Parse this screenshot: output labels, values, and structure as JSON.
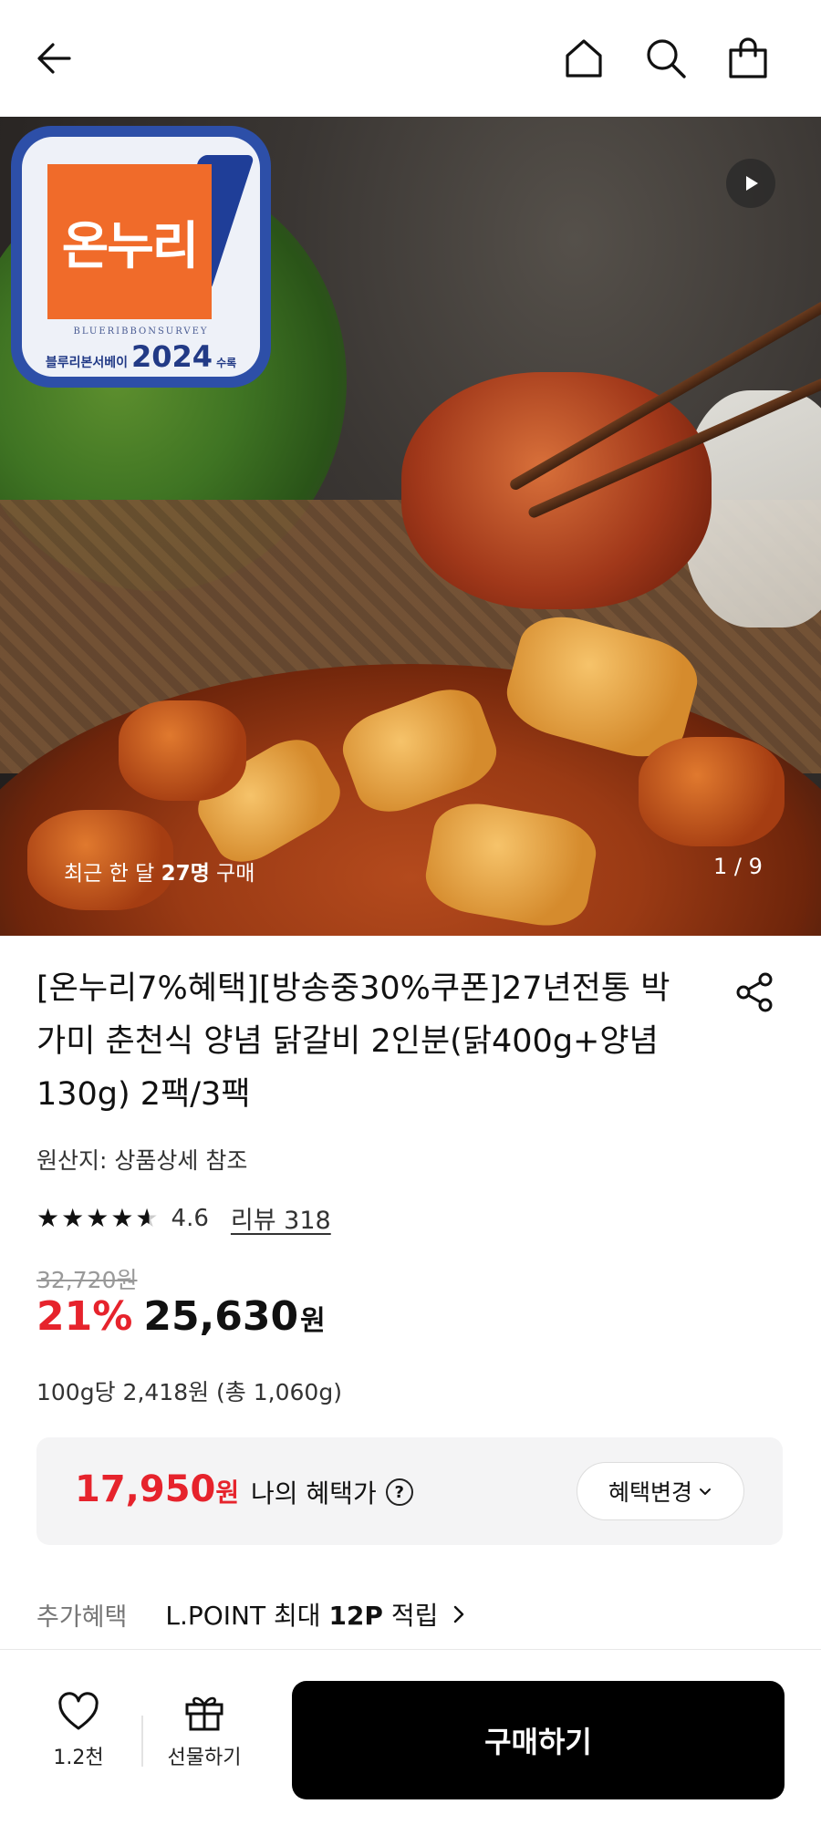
{
  "nav": {
    "back_icon": "back-arrow-icon",
    "home_icon": "home-icon",
    "search_icon": "search-icon",
    "cart_icon": "shopping-bag-icon"
  },
  "hero": {
    "badge": {
      "logo_text": "온누리",
      "survey_text": "BLUERIBBONSURVEY",
      "label": "블루리본서베이",
      "year": "2024",
      "suffix": "수록"
    },
    "purchase_prefix": "최근 한 달 ",
    "purchase_count": "27명",
    "purchase_suffix": " 구매",
    "page_indicator": "1 / 9",
    "play_icon": "play-icon"
  },
  "product": {
    "title": "[온누리7%혜택][방송중30%쿠폰]27년전통 박가미 춘천식 양념 닭갈비 2인분(닭400g+양념 130g) 2팩/3팩",
    "origin": "원산지: 상품상세 참조",
    "rating": "4.6",
    "rating_value": 4.6,
    "review_link": "리뷰 318",
    "original_price": "32,720원",
    "discount": "21%",
    "price": "25,630",
    "price_unit": "원",
    "unit_price": "100g당 2,418원 (총 1,060g)"
  },
  "benefit": {
    "price": "17,950",
    "price_unit": "원",
    "label": "나의 혜택가",
    "help_symbol": "?",
    "change_button": "혜택변경"
  },
  "extra": {
    "label": "추가혜택",
    "value_prefix": "L.POINT 최대 ",
    "value_bold": "12P",
    "value_suffix": " 적립"
  },
  "bottom": {
    "like_count": "1.2천",
    "gift_label": "선물하기",
    "buy_button": "구매하기"
  },
  "colors": {
    "accent_red": "#e6232c",
    "buy_button": "#000000",
    "badge_blue": "#2d4fa8",
    "badge_orange": "#f06b2a"
  }
}
